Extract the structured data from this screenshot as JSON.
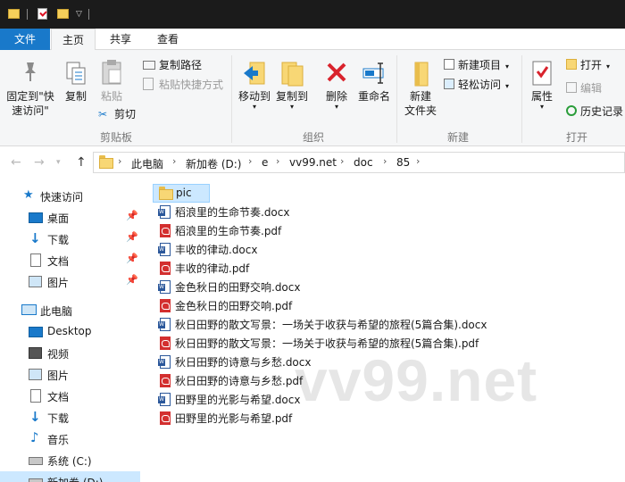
{
  "menubar": {
    "file": "文件",
    "home": "主页",
    "share": "共享",
    "view": "查看"
  },
  "ribbon": {
    "pin": "固定到\"快",
    "pin2": "速访问\"",
    "copy": "复制",
    "paste": "粘贴",
    "copy_path": "复制路径",
    "paste_shortcut": "粘贴快捷方式",
    "cut": "剪切",
    "clipboard_group": "剪贴板",
    "move_to": "移动到",
    "copy_to": "复制到",
    "delete": "删除",
    "rename": "重命名",
    "organize_group": "组织",
    "new_folder": "新建",
    "new_folder2": "文件夹",
    "new_item": "新建项目",
    "easy_access": "轻松访问",
    "new_group": "新建",
    "properties": "属性",
    "open": "打开",
    "edit": "编辑",
    "history": "历史记录",
    "open_group": "打开"
  },
  "address": {
    "crumbs": [
      "此电脑",
      "新加卷 (D:)",
      "e",
      "vv99.net",
      "doc",
      "85"
    ]
  },
  "sidebar": {
    "quick_access": "快速访问",
    "desktop": "桌面",
    "downloads": "下载",
    "documents": "文档",
    "pictures": "图片",
    "this_pc": "此电脑",
    "desktop_en": "Desktop",
    "videos": "视频",
    "pictures2": "图片",
    "documents2": "文档",
    "downloads2": "下载",
    "music": "音乐",
    "system_c": "系统 (C:)",
    "new_vol_d": "新加卷 (D:)"
  },
  "files": [
    {
      "name": "pic",
      "type": "folder"
    },
    {
      "name": "稻浪里的生命节奏.docx",
      "type": "docx"
    },
    {
      "name": "稻浪里的生命节奏.pdf",
      "type": "pdf"
    },
    {
      "name": "丰收的律动.docx",
      "type": "docx"
    },
    {
      "name": "丰收的律动.pdf",
      "type": "pdf"
    },
    {
      "name": "金色秋日的田野交响.docx",
      "type": "docx"
    },
    {
      "name": "金色秋日的田野交响.pdf",
      "type": "pdf"
    },
    {
      "name": "秋日田野的散文写景：一场关于收获与希望的旅程(5篇合集).docx",
      "type": "docx"
    },
    {
      "name": "秋日田野的散文写景：一场关于收获与希望的旅程(5篇合集).pdf",
      "type": "pdf"
    },
    {
      "name": "秋日田野的诗意与乡愁.docx",
      "type": "docx"
    },
    {
      "name": "秋日田野的诗意与乡愁.pdf",
      "type": "pdf"
    },
    {
      "name": "田野里的光影与希望.docx",
      "type": "docx"
    },
    {
      "name": "田野里的光影与希望.pdf",
      "type": "pdf"
    }
  ],
  "watermark": "vv99.net"
}
